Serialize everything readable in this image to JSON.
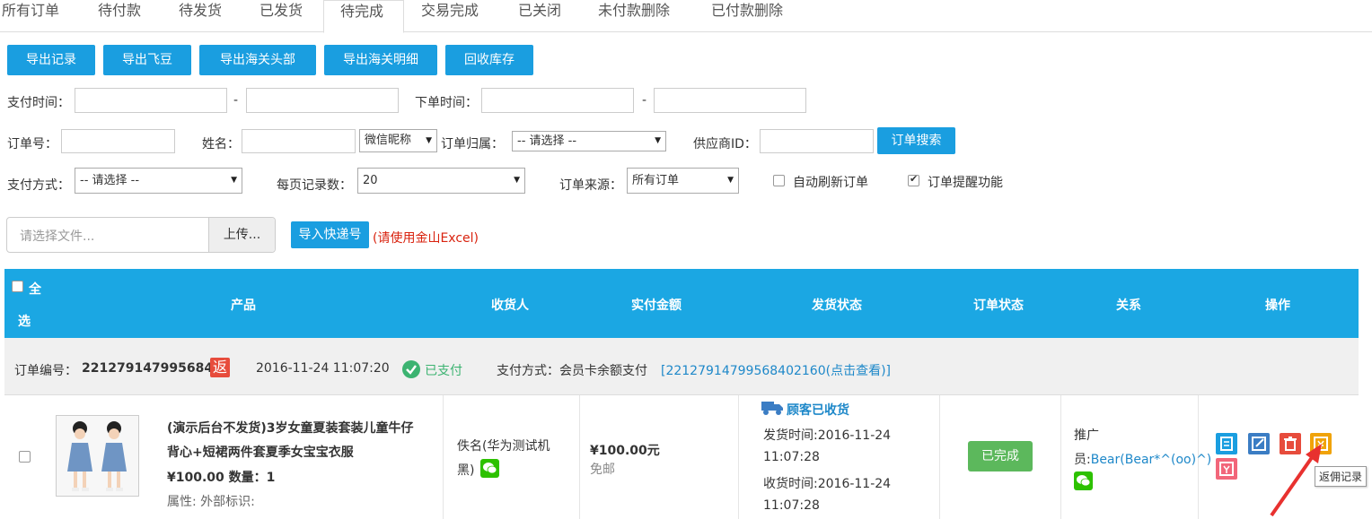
{
  "tabs": [
    "所有订单",
    "待付款",
    "待发货",
    "已发货",
    "待完成",
    "交易完成",
    "已关闭",
    "未付款删除",
    "已付款删除"
  ],
  "active_tab": "待完成",
  "toolbar": {
    "export_records": "导出记录",
    "export_feidou": "导出飞豆",
    "export_customs_header": "导出海关头部",
    "export_customs_detail": "导出海关明细",
    "recycle_stock": "回收库存"
  },
  "filters": {
    "pay_time_label": "支付时间：",
    "dash": "-",
    "order_time_label": "下单时间：",
    "order_no_label": "订单号：",
    "name_label": "姓名：",
    "nickname_select": "微信昵称",
    "order_owner_label": "订单归属：",
    "please_select": "-- 请选择 --",
    "supplier_id_label": "供应商ID：",
    "search_button": "订单搜索",
    "pay_method_label": "支付方式：",
    "per_page_label": "每页记录数：",
    "per_page_value": "20",
    "order_source_label": "订单来源：",
    "order_source_value": "所有订单",
    "auto_refresh_label": "自动刷新订单",
    "auto_refresh_checked": false,
    "order_remind_label": "订单提醒功能",
    "order_remind_checked": true
  },
  "import": {
    "file_placeholder": "请选择文件...",
    "upload_button": "上传...",
    "import_tracking_button": "导入快递号",
    "hint": "(请使用金山Excel)"
  },
  "table": {
    "select_all_1": "全",
    "select_all_2": "选",
    "columns": [
      "产品",
      "收货人",
      "实付金额",
      "发货状态",
      "订单状态",
      "关系",
      "操作"
    ]
  },
  "order": {
    "order_no_label": "订单编号：",
    "order_no": "22127914799568400",
    "return_badge": "返",
    "time": "2016-11-24 11:07:20",
    "paid_status": "已支付",
    "pay_method_label": "支付方式：会员卡余额支付",
    "pay_ref_link": "[22127914799568402160(点击查看)]",
    "product_title_1": "(演示后台不发货)3岁女童夏装套装儿童牛仔",
    "product_title_2": "背心+短裙两件套夏季女宝宝衣服",
    "price_qty_prefix": "¥100.00 数量：",
    "qty": "1",
    "attributes": "属性: 外部标识:",
    "receiver_1": "佚名(华为测试机",
    "receiver_2": "黑)",
    "amount": "¥100.00元",
    "shipping_free": "免邮",
    "ship_status": "顾客已收货",
    "ship_time_1": "发货时间:2016-11-24",
    "ship_time_2": "11:07:28",
    "receive_time_1": "收货时间:2016-11-24",
    "receive_time_2": "11:07:28",
    "order_status": "已完成",
    "relation_1": "推广",
    "relation_2_prefix": "员:",
    "relation_link": "Bear(Bear*^(oo)^)",
    "tooltip": "返佣记录"
  },
  "icons": [
    "checkmark-circle-icon",
    "truck-icon",
    "wechat-icon",
    "detail-icon",
    "edit-icon",
    "delete-icon",
    "commission-icon",
    "refund-icon",
    "arrow-icon"
  ],
  "colors": {
    "primary": "#1a9ee0",
    "header": "#1ba7e3",
    "success": "#5cb85c",
    "paid": "#3cb371",
    "link": "#1e88c9",
    "danger": "#e74c3c",
    "hint": "#d9230f"
  }
}
